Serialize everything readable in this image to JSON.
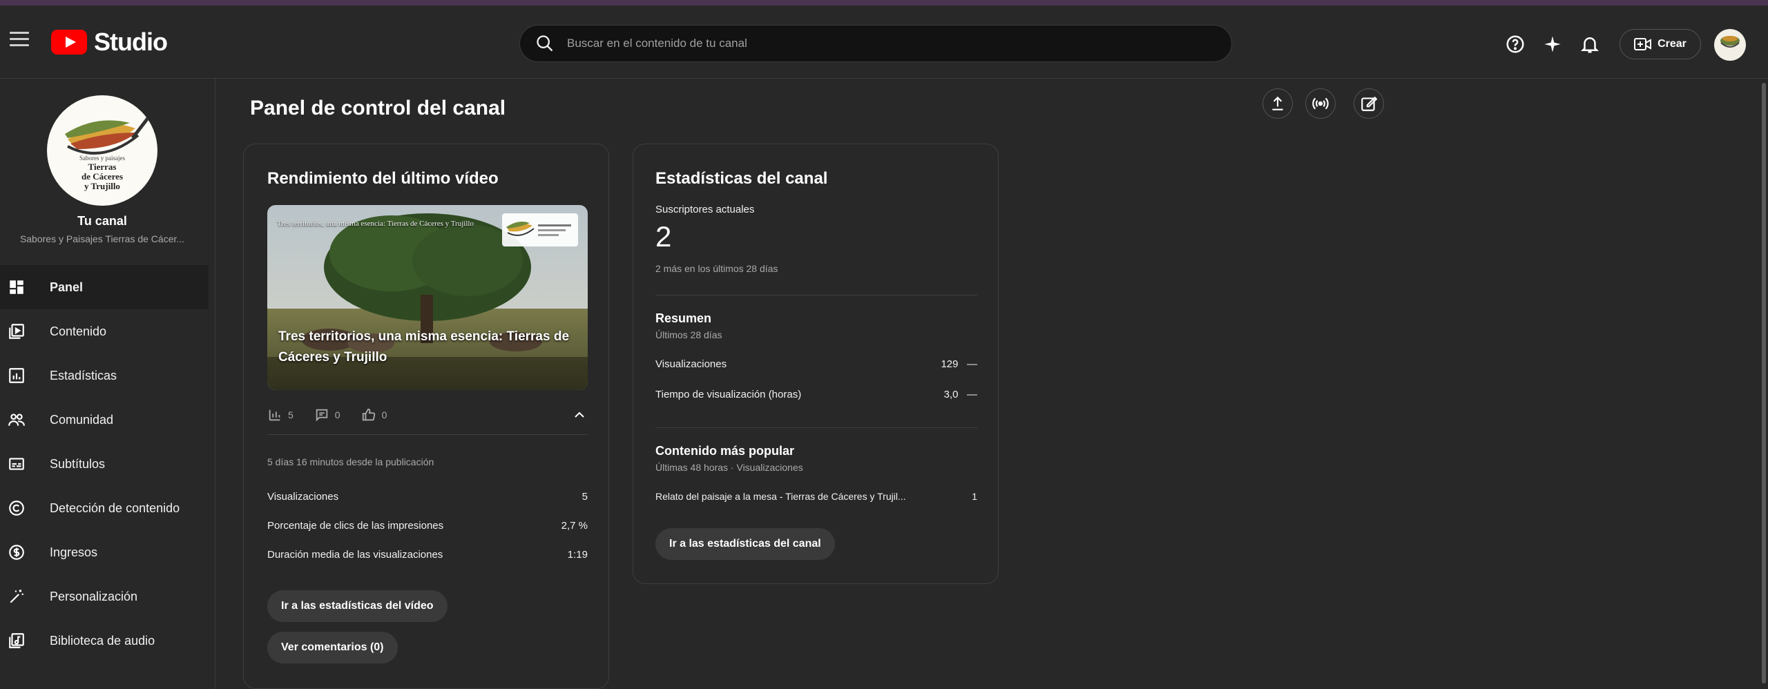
{
  "header": {
    "logo_text": "Studio",
    "search_placeholder": "Buscar en el contenido de tu canal",
    "create_label": "Crear"
  },
  "sidebar": {
    "channel_title": "Tu canal",
    "channel_subtitle": "Sabores y Paisajes Tierras de Cácer...",
    "avatar_text": [
      "Sabores y paisajes",
      "Tierras",
      "de Cáceres",
      "y Trujillo"
    ],
    "items": [
      {
        "label": "Panel",
        "icon": "dashboard-icon",
        "active": true
      },
      {
        "label": "Contenido",
        "icon": "content-icon"
      },
      {
        "label": "Estadísticas",
        "icon": "analytics-icon"
      },
      {
        "label": "Comunidad",
        "icon": "community-icon"
      },
      {
        "label": "Subtítulos",
        "icon": "subtitles-icon"
      },
      {
        "label": "Detección de contenido",
        "icon": "copyright-icon"
      },
      {
        "label": "Ingresos",
        "icon": "monetization-icon"
      },
      {
        "label": "Personalización",
        "icon": "magic-wand-icon"
      },
      {
        "label": "Biblioteca de audio",
        "icon": "audio-library-icon"
      }
    ]
  },
  "page": {
    "title": "Panel de control del canal"
  },
  "latest_video": {
    "card_title": "Rendimiento del último vídeo",
    "thumb_title": "Tres territorios, una misma esencia: Tierras de Cáceres y Trujillo",
    "thumb_overlay": "Tres territorios, una misma esencia: Tierras de Cáceres y Trujillo",
    "views_count": "5",
    "comments_count": "0",
    "likes_count": "0",
    "published": "5 días 16 minutos desde la publicación",
    "stats": [
      {
        "label": "Visualizaciones",
        "value": "5"
      },
      {
        "label": "Porcentaje de clics de las impresiones",
        "value": "2,7 %"
      },
      {
        "label": "Duración media de las visualizaciones",
        "value": "1:19"
      }
    ],
    "btn_stats": "Ir a las estadísticas del vídeo",
    "btn_comments": "Ver comentarios (0)"
  },
  "channel_stats": {
    "card_title": "Estadísticas del canal",
    "subs_label": "Suscriptores actuales",
    "subs_value": "2",
    "subs_delta": "2 más en los últimos 28 días",
    "summary_title": "Resumen",
    "summary_period": "Últimos 28 días",
    "summary": [
      {
        "label": "Visualizaciones",
        "value": "129",
        "trend": "—"
      },
      {
        "label": "Tiempo de visualización (horas)",
        "value": "3,0",
        "trend": "—"
      }
    ],
    "popular_title": "Contenido más popular",
    "popular_period": "Últimas 48 horas · Visualizaciones",
    "popular_item": {
      "label": "Relato del paisaje a la mesa - Tierras de Cáceres y Trujil...",
      "value": "1"
    },
    "btn_stats": "Ir a las estadísticas del canal"
  }
}
